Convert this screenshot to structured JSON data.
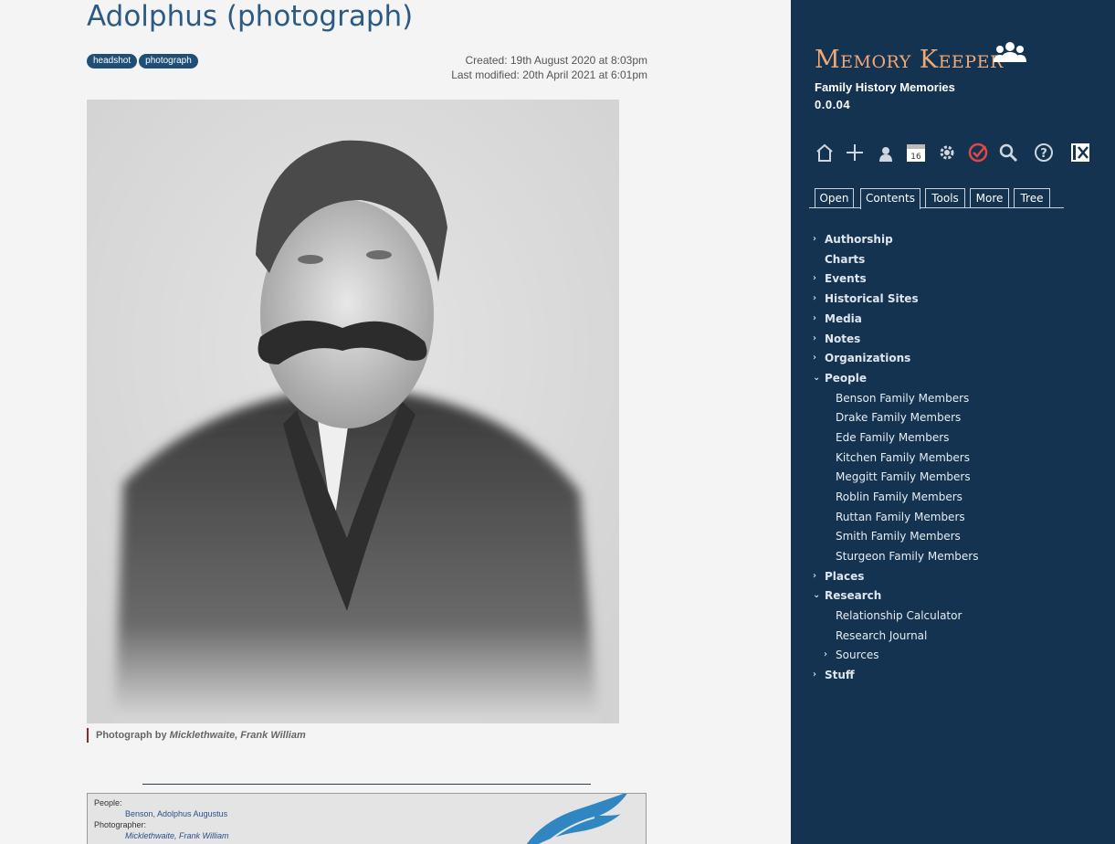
{
  "page": {
    "title": "Adolphus (photograph)",
    "tags": [
      "headshot",
      "photograph"
    ],
    "created": "Created: 19th August 2020 at 8:03pm",
    "modified": "Last modified: 20th April 2021 at 6:01pm",
    "caption_prefix": "Photograph by ",
    "caption_author": "Micklethwaite, Frank William",
    "info": {
      "people_label": "People:",
      "people_value": "Benson, Adolphus Augustus",
      "photographer_label": "Photographer:",
      "photographer_value": "Micklethwaite, Frank William"
    }
  },
  "sidebar": {
    "app_title": "Memory Keeper",
    "subtitle": "Family History Memories",
    "version": "0.0.04",
    "toolbar_icons": [
      "home-icon",
      "plus-icon",
      "person-icon",
      "calendar-icon",
      "gear-icon",
      "check-icon",
      "search-icon",
      "help-icon",
      "close-panel-icon"
    ],
    "calendar_day": "16",
    "tabs": [
      "Open",
      "Contents",
      "Tools",
      "More",
      "Tree"
    ],
    "active_tab": "Contents",
    "tree": [
      {
        "label": "Authorship",
        "chev": "›",
        "level": 0
      },
      {
        "label": "Charts",
        "chev": "",
        "level": 0
      },
      {
        "label": "Events",
        "chev": "›",
        "level": 0
      },
      {
        "label": "Historical Sites",
        "chev": "›",
        "level": 0
      },
      {
        "label": "Media",
        "chev": "›",
        "level": 0
      },
      {
        "label": "Notes",
        "chev": "›",
        "level": 0
      },
      {
        "label": "Organizations",
        "chev": "›",
        "level": 0
      },
      {
        "label": "People",
        "chev": "⌄",
        "level": 0
      },
      {
        "label": "Benson Family Members",
        "chev": "",
        "level": 1
      },
      {
        "label": "Drake Family Members",
        "chev": "",
        "level": 1
      },
      {
        "label": "Ede Family Members",
        "chev": "",
        "level": 1
      },
      {
        "label": "Kitchen Family Members",
        "chev": "",
        "level": 1
      },
      {
        "label": "Meggitt Family Members",
        "chev": "",
        "level": 1
      },
      {
        "label": "Roblin Family Members",
        "chev": "",
        "level": 1
      },
      {
        "label": "Ruttan Family Members",
        "chev": "",
        "level": 1
      },
      {
        "label": "Smith Family Members",
        "chev": "",
        "level": 1
      },
      {
        "label": "Sturgeon Family Members",
        "chev": "",
        "level": 1
      },
      {
        "label": "Places",
        "chev": "›",
        "level": 0
      },
      {
        "label": "Research",
        "chev": "⌄",
        "level": 0
      },
      {
        "label": "Relationship Calculator",
        "chev": "",
        "level": 1
      },
      {
        "label": "Research Journal",
        "chev": "",
        "level": 1
      },
      {
        "label": "Sources",
        "chev": "›",
        "level": 1
      },
      {
        "label": "Stuff",
        "chev": "›",
        "level": 0
      }
    ]
  }
}
